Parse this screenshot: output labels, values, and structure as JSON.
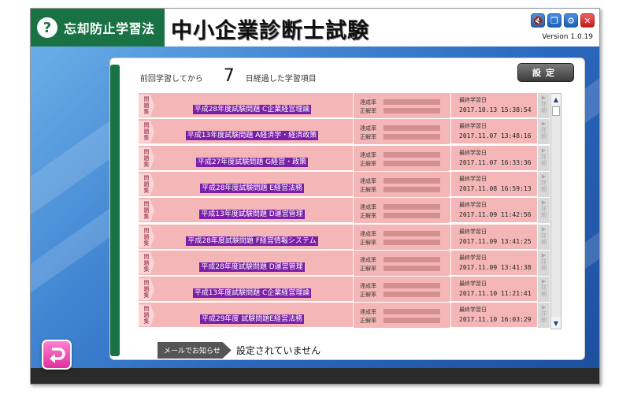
{
  "header": {
    "app_name": "忘却防止学習法",
    "exam_title": "中小企業診断士試験",
    "version": "Version 1.0.19",
    "controls": {
      "mute": "🔇",
      "info": "❐",
      "gear": "⚙",
      "close": "✕"
    }
  },
  "summary": {
    "prefix": "前回学習してから",
    "days": "7",
    "suffix": "日経過した学習項目"
  },
  "settings_label": "設定",
  "columns": {
    "tag": "問題集",
    "achievement": "達成率",
    "correct": "正解率",
    "last_date": "最終学習日",
    "detail": "詳細"
  },
  "rows": [
    {
      "title": "平成28年度試験問題 C企業経営理論",
      "date": "2017.10.13 15:38:54"
    },
    {
      "title": "平成13年度試験問題 A経済学・経済政策",
      "date": "2017.11.07 13:48:16"
    },
    {
      "title": "平成27年度試験問題 G経営・政策",
      "date": "2017.11.07 16:33:36"
    },
    {
      "title": "平成28年度試験問題 E経営法務",
      "date": "2017.11.08 16:59:13"
    },
    {
      "title": "平成13年度試験問題 D運営管理",
      "date": "2017.11.09 11:42:56"
    },
    {
      "title": "平成28年度試験問題 F経営情報システム",
      "date": "2017.11.09 13:41:25"
    },
    {
      "title": "平成28年度試験問題 D運営管理",
      "date": "2017.11.09 13:41:38"
    },
    {
      "title": "平成13年度試験問題 C企業経営理論",
      "date": "2017.11.10 11:21:41"
    },
    {
      "title": "平成29年度 試験問題E経営法務",
      "date": "2017.11.10 16:03:29"
    }
  ],
  "mail": {
    "label": "メールでお知らせ",
    "status": "設定されていません"
  },
  "colors": {
    "brand_green": "#197243",
    "row_pink": "#f4b6b6",
    "title_highlight": "#7a1fa8",
    "back_pink": "#e0309e"
  }
}
